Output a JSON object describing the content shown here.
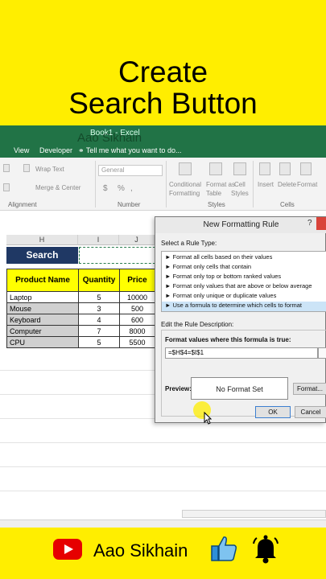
{
  "banner": {
    "line1": "Create",
    "line2": "Search Button"
  },
  "excel": {
    "book_title": "Book1 - Excel",
    "watermark": "Aao Sikhain",
    "menu_tabs": [
      "View",
      "Developer"
    ],
    "tell_me": "Tell me what you want to do...",
    "ribbon": {
      "wrap_text": "Wrap Text",
      "merge_center": "Merge & Center",
      "number_format": "General",
      "currency": "$",
      "percent": "%",
      "comma": ",",
      "conditional": [
        "Conditional",
        "Formatting"
      ],
      "format_table": [
        "Format as",
        "Table"
      ],
      "cell_styles": [
        "Cell",
        "Styles"
      ],
      "insert": "Insert",
      "delete": "Delete",
      "format": "Format",
      "groups": [
        "Alignment",
        "Number",
        "Styles",
        "Cells"
      ]
    },
    "columns": [
      "H",
      "I",
      "J"
    ],
    "search_label": "Search",
    "table": {
      "headers": [
        "Product Name",
        "Quantity",
        "Price"
      ],
      "rows": [
        [
          "Laptop",
          "5",
          "10000"
        ],
        [
          "Mouse",
          "3",
          "500"
        ],
        [
          "Keyboard",
          "4",
          "600"
        ],
        [
          "Computer",
          "7",
          "8000"
        ],
        [
          "CPU",
          "5",
          "5500"
        ]
      ]
    }
  },
  "dialog": {
    "title": "New Formatting Rule",
    "help": "?",
    "select_rule_type": "Select a Rule Type:",
    "rules": [
      "► Format all cells based on their values",
      "► Format only cells that contain",
      "► Format only top or bottom ranked values",
      "► Format only values that are above or below average",
      "► Format only unique or duplicate values",
      "► Use a formula to determine which cells to format"
    ],
    "edit_description": "Edit the Rule Description:",
    "formula_label": "Format values where this formula is true:",
    "formula_value": "=$H$4=$I$1",
    "preview_label": "Preview:",
    "preview_text": "No Format Set",
    "format_button": "Format...",
    "ok_button": "OK",
    "cancel_button": "Cancel"
  },
  "footer": {
    "brand": "Aao Sikhain"
  },
  "colors": {
    "banner": "#ffee00",
    "excel_green": "#217346",
    "search_fill": "#1f3864",
    "header_fill": "#ffff00",
    "youtube_red": "#e60000"
  },
  "icons": [
    "youtube-icon",
    "thumbs-up-icon",
    "bell-icon",
    "bulb-icon",
    "mouse-cursor-icon"
  ]
}
